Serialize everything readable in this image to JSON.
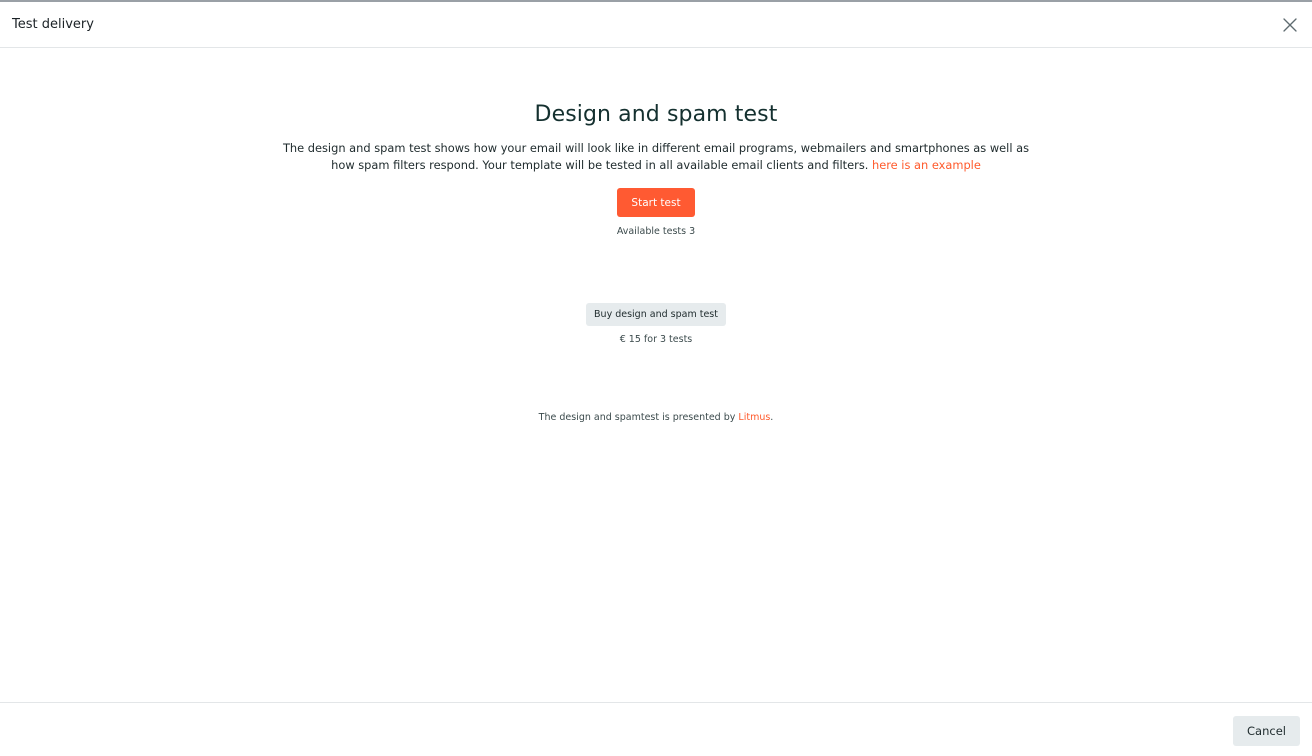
{
  "dialog": {
    "title": "Test delivery",
    "close_icon": "close-icon"
  },
  "main": {
    "title": "Design and spam test",
    "description": "The design and spam test shows how your email will look like in different email programs, webmailers and smartphones as well as how spam filters respond. Your template will be tested in all available email clients and filters.",
    "example_link": "here is an example",
    "start_button": "Start test",
    "available_tests": "Available tests 3",
    "buy_button": "Buy design and spam test",
    "price": "€ 15 for 3 tests",
    "presented_prefix": "The design and spamtest is presented by",
    "presented_link": "Litmus",
    "presented_suffix": "."
  },
  "footer": {
    "cancel_button": "Cancel"
  },
  "colors": {
    "accent": "#ff5a32",
    "link": "#ff5a2c",
    "secondary_button": "#e6ebed",
    "title": "#14302f"
  }
}
